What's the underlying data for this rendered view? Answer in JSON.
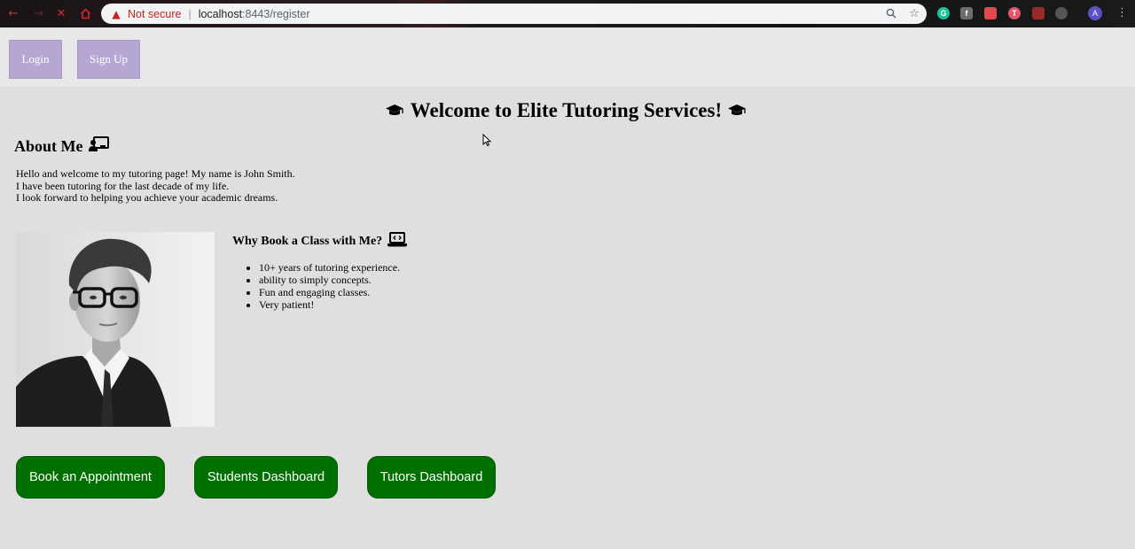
{
  "browser": {
    "security_text": "Not secure",
    "separator": "|",
    "url_host": "localhost",
    "url_path": ":8443/register",
    "avatar_letter": "A",
    "ext_grammarly": "G",
    "ext_facebook": "f",
    "ext_t": "T"
  },
  "nav": {
    "login_label": "Login",
    "signup_label": "Sign Up",
    "button_color": "#b5a6d2"
  },
  "page": {
    "title": "Welcome to Elite Tutoring Services!",
    "title_icon": "graduation-cap-icon",
    "about_heading": "About Me",
    "about_icon": "chalkboard-teacher-icon",
    "intro_lines": [
      "Hello and welcome to my tutoring page! My name is John Smith.",
      "I have been tutoring for the last decade of my life.",
      "I look forward to helping you achieve your academic dreams."
    ],
    "why_heading": "Why Book a Class with Me?",
    "why_icon": "laptop-code-icon",
    "why_items": [
      "10+ years of tutoring experience.",
      "ability to simply concepts.",
      "Fun and engaging classes.",
      "Very patient!"
    ]
  },
  "actions": {
    "book_label": "Book an Appointment",
    "students_label": "Students Dashboard",
    "tutors_label": "Tutors Dashboard",
    "button_color": "#007000"
  }
}
